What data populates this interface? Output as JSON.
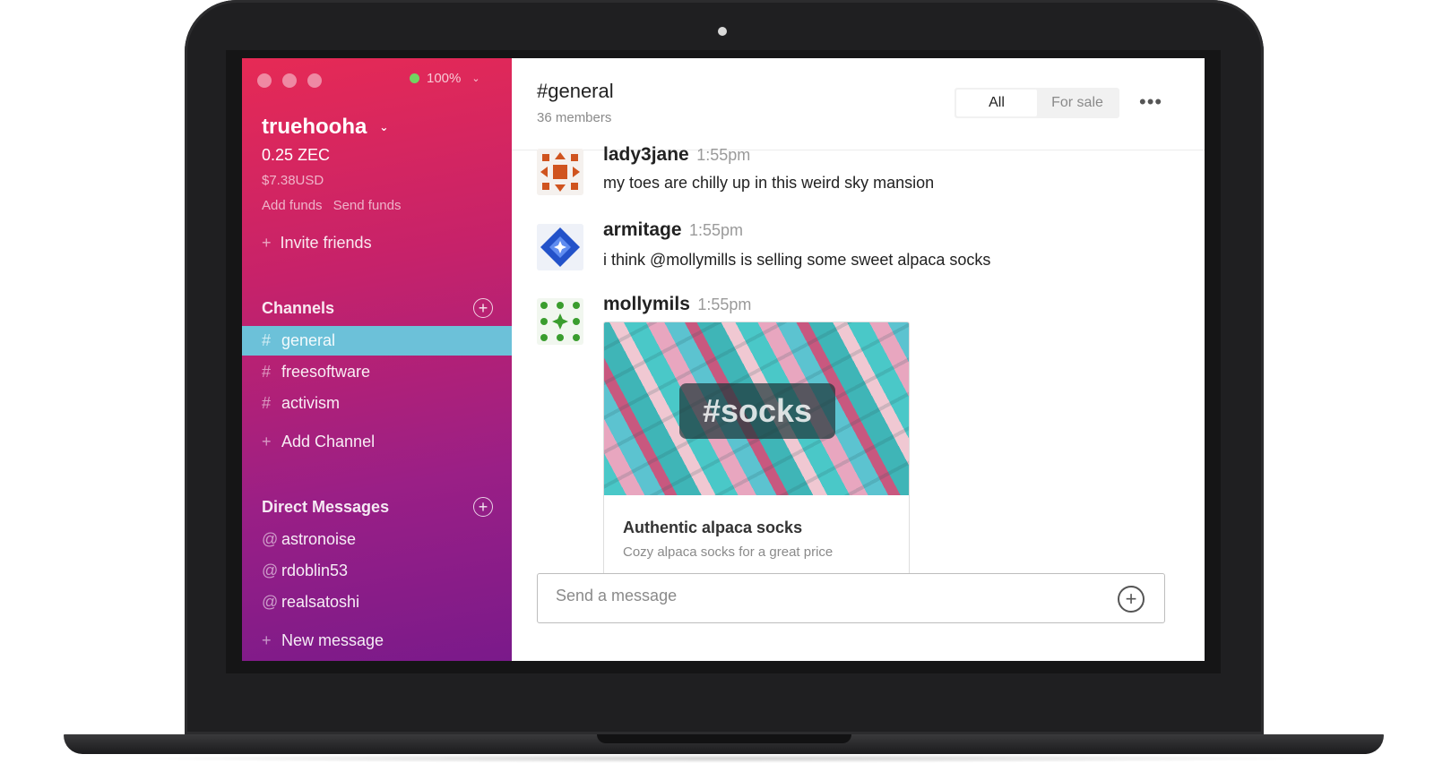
{
  "sidebar": {
    "connection_percent": "100%",
    "wallet_name": "truehooha",
    "balance": "0.25 ZEC",
    "balance_usd": "$7.38USD",
    "add_funds": "Add funds",
    "send_funds": "Send funds",
    "invite_friends": "Invite friends",
    "channels_title": "Channels",
    "channels": [
      {
        "prefix": "#",
        "name": "general",
        "active": true
      },
      {
        "prefix": "#",
        "name": "freesoftware",
        "active": false
      },
      {
        "prefix": "#",
        "name": "activism",
        "active": false
      }
    ],
    "add_channel": "Add Channel",
    "dm_title": "Direct Messages",
    "direct_messages": [
      {
        "prefix": "@",
        "name": "astronoise"
      },
      {
        "prefix": "@",
        "name": "rdoblin53"
      },
      {
        "prefix": "@",
        "name": "realsatoshi"
      }
    ],
    "new_message": "New message",
    "plus_glyph": "+"
  },
  "header": {
    "channel": "#general",
    "members": "36 members",
    "filters": [
      "All",
      "For sale"
    ],
    "active_filter": "All",
    "more_glyph": "•••"
  },
  "messages": [
    {
      "author": "lady3jane",
      "time": "1:55pm",
      "text": "my toes are chilly up in this weird sky mansion",
      "avatar_color": "#d0541f"
    },
    {
      "author": "armitage",
      "time": "1:55pm",
      "text": "i think @mollymills is selling some sweet alpaca socks",
      "avatar_color": "#2352c9"
    },
    {
      "author": "mollymils",
      "time": "1:55pm",
      "text": "",
      "avatar_color": "#3a9d2e"
    }
  ],
  "listing": {
    "tag": "#socks",
    "title": "Authentic alpaca socks",
    "description": "Cozy alpaca socks for a great price"
  },
  "composer": {
    "placeholder": "Send a message"
  },
  "colors": {
    "sidebar_top": "#e62a55",
    "sidebar_bottom": "#7a1a8a",
    "active_channel": "#6cc1d9",
    "online": "#72d461"
  }
}
